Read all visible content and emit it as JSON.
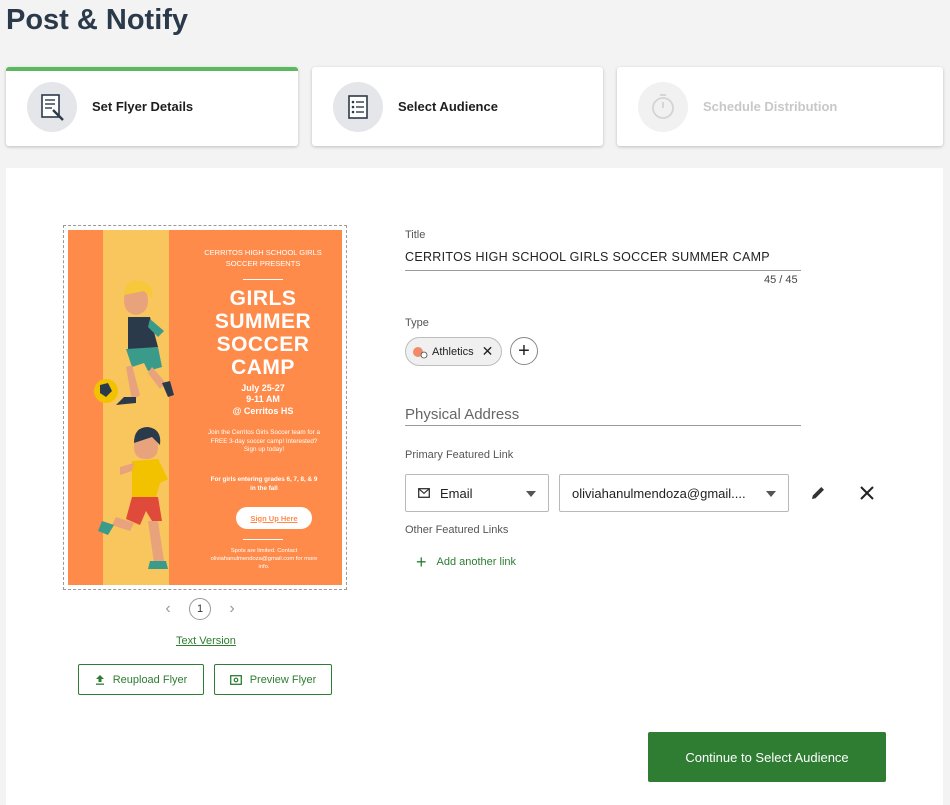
{
  "page_title": "Post & Notify",
  "steps": [
    {
      "label": "Set Flyer Details",
      "icon": "flyer-details-icon",
      "state": "active"
    },
    {
      "label": "Select Audience",
      "icon": "audience-list-icon",
      "state": "default"
    },
    {
      "label": "Schedule Distribution",
      "icon": "stopwatch-icon",
      "state": "disabled"
    }
  ],
  "flyer": {
    "header": "CERRITOS HIGH SCHOOL GIRLS SOCCER PRESENTS",
    "title_lines": [
      "GIRLS",
      "SUMMER",
      "SOCCER",
      "CAMP"
    ],
    "dates": "July 25-27",
    "time": "9-11 AM",
    "location": "@ Cerritos HS",
    "blurb": "Join the Cerritos Girls Soccer team for a FREE 3-day soccer camp! Interested? Sign up today!",
    "grades": "For girls entering grades 6, 7, 8, & 9 in the fall",
    "signup_label": "Sign Up Here",
    "footer": "Spots are limited. Contact oliviahanulmendoza@gmail.com for more info."
  },
  "pager": {
    "page": "1"
  },
  "text_version_label": "Text Version",
  "buttons": {
    "reupload": "Reupload Flyer",
    "preview": "Preview Flyer",
    "continue": "Continue to Select Audience"
  },
  "form": {
    "title_label": "Title",
    "title_value": "CERRITOS HIGH SCHOOL GIRLS SOCCER SUMMER CAMP",
    "title_counter": "45 / 45",
    "type_label": "Type",
    "type_chip": "Athletics",
    "address_placeholder": "Physical Address",
    "primary_link_label": "Primary Featured Link",
    "link_type": "Email",
    "link_value": "oliviahanulmendoza@gmail....",
    "other_links_label": "Other Featured Links",
    "add_link_label": "Add another link"
  },
  "colors": {
    "accent_green": "#2e7d32",
    "progress_green": "#5cb85c",
    "flyer_orange": "#ff8b4a",
    "flyer_yellow": "#f9c55d"
  }
}
